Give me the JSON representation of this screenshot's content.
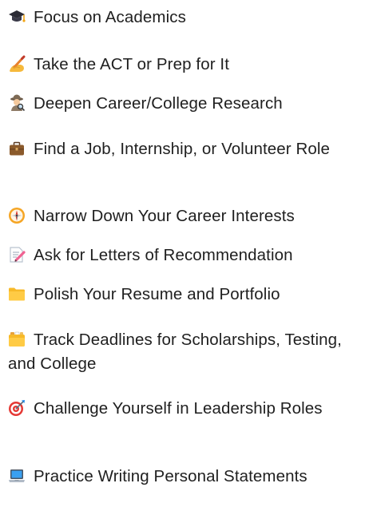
{
  "items": [
    {
      "icon": "graduation-cap-icon",
      "text": "Focus on Academics"
    },
    {
      "icon": "writing-hand-icon",
      "text": "Take the ACT or Prep for It"
    },
    {
      "icon": "detective-icon",
      "text": "Deepen Career/College Research"
    },
    {
      "icon": "briefcase-icon",
      "text": "Find a Job, Internship, or Volunteer Role"
    },
    {
      "icon": "compass-icon",
      "text": "Narrow Down Your Career Interests"
    },
    {
      "icon": "memo-icon",
      "text": "Ask for Letters of Recommendation"
    },
    {
      "icon": "folder-icon",
      "text": "Polish Your Resume and Portfolio"
    },
    {
      "icon": "card-index-dividers-icon",
      "text": "Track Deadlines for Scholarships, Testing, and College"
    },
    {
      "icon": "direct-hit-icon",
      "text": "Challenge Yourself in Leadership Roles"
    },
    {
      "icon": "laptop-icon",
      "text": "Practice Writing Personal Statements"
    }
  ]
}
